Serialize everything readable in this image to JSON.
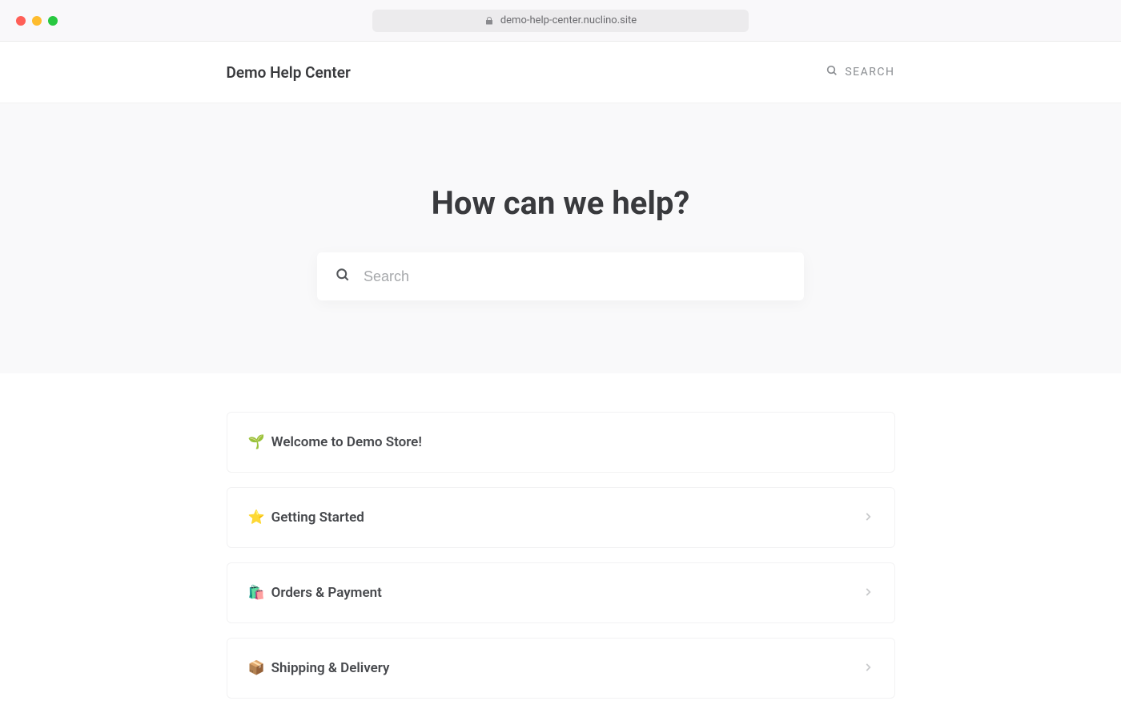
{
  "browser": {
    "url": "demo-help-center.nuclino.site"
  },
  "header": {
    "site_title": "Demo Help Center",
    "search_label": "SEARCH"
  },
  "hero": {
    "heading": "How can we help?",
    "search_placeholder": "Search"
  },
  "categories": [
    {
      "emoji": "🌱",
      "label": "Welcome to Demo Store!",
      "has_chevron": false
    },
    {
      "emoji": "⭐",
      "label": "Getting Started",
      "has_chevron": true
    },
    {
      "emoji": "🛍️",
      "label": "Orders & Payment",
      "has_chevron": true
    },
    {
      "emoji": "📦",
      "label": "Shipping & Delivery",
      "has_chevron": true
    }
  ]
}
